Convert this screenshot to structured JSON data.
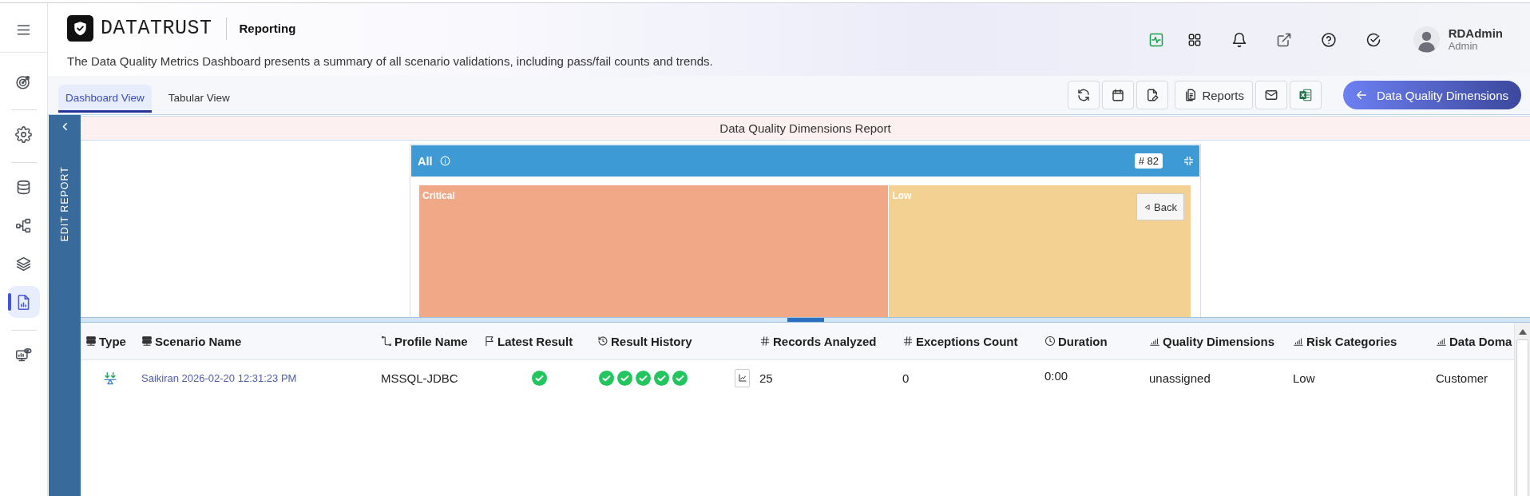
{
  "sidebar": {
    "groups": [
      {
        "items": [
          {
            "selected": false
          }
        ]
      },
      {
        "items": [
          {
            "selected": false
          }
        ]
      },
      {
        "items": [
          {
            "selected": false
          },
          {
            "selected": false
          },
          {
            "selected": false
          },
          {
            "selected": true
          }
        ]
      },
      {
        "items": [
          {
            "selected": false
          }
        ]
      }
    ]
  },
  "header": {
    "brand": "DATATRUST",
    "section": "Reporting",
    "description": "The Data Quality Metrics Dashboard presents a summary of all scenario validations, including pass/fail counts and trends."
  },
  "user": {
    "name": "RDAdmin",
    "role": "Admin"
  },
  "tabs": [
    {
      "label": "Dashboard View",
      "selected": true
    },
    {
      "label": "Tabular View",
      "selected": false
    }
  ],
  "toolbar": {
    "reports_button": "Reports",
    "dimensions_button": "Data Quality Dimensions"
  },
  "edit_panel": {
    "label": "EDIT REPORT"
  },
  "report": {
    "title": "Data Quality Dimensions Report",
    "treemap": {
      "title": "All",
      "count": "# 82",
      "back_button": "Back",
      "cells": [
        {
          "label": "Critical",
          "color": "#f0a886"
        },
        {
          "label": "Low",
          "color": "#f3d192"
        }
      ]
    }
  },
  "table": {
    "columns": [
      {
        "label": "Type"
      },
      {
        "label": "Scenario Name"
      },
      {
        "label": "Profile Name"
      },
      {
        "label": "Latest Result"
      },
      {
        "label": "Result History"
      },
      {
        "label": "Records Analyzed"
      },
      {
        "label": "Exceptions Count"
      },
      {
        "label": "Duration"
      },
      {
        "label": "Quality Dimensions"
      },
      {
        "label": "Risk Categories"
      },
      {
        "label": "Data Doma"
      }
    ],
    "rows": [
      {
        "scenario": "Saikiran 2026-02-20 12:31:23 PM",
        "profile": "MSSQL-JDBC",
        "latest_passed": true,
        "history": [
          {
            "passed": true
          },
          {
            "passed": true
          },
          {
            "passed": true
          },
          {
            "passed": true
          },
          {
            "passed": true
          }
        ],
        "records": "25",
        "exceptions": "0",
        "duration": "0:00",
        "quality_dimension": "unassigned",
        "risk_category": "Low",
        "data_domain": "Customer"
      }
    ]
  }
}
